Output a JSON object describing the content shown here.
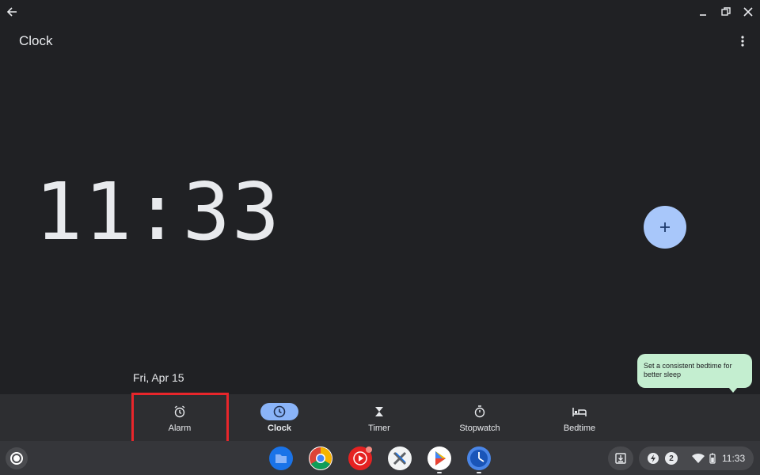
{
  "window": {
    "app_title": "Clock"
  },
  "clock": {
    "time": "11:33",
    "date": "Fri, Apr 15"
  },
  "tooltip": {
    "text": "Set a consistent bedtime for better sleep"
  },
  "nav": {
    "items": [
      {
        "label": "Alarm",
        "icon": "alarm-icon",
        "active": false
      },
      {
        "label": "Clock",
        "icon": "clock-icon",
        "active": true
      },
      {
        "label": "Timer",
        "icon": "hourglass-icon",
        "active": false
      },
      {
        "label": "Stopwatch",
        "icon": "stopwatch-icon",
        "active": false
      },
      {
        "label": "Bedtime",
        "icon": "bed-icon",
        "active": false
      }
    ]
  },
  "shelf": {
    "apps": [
      "files-icon",
      "chrome-icon",
      "youtube-music-icon",
      "app-icon",
      "play-store-icon",
      "clock-app-icon"
    ]
  },
  "tray": {
    "notification_count": "2",
    "time": "11:33"
  },
  "colors": {
    "accent": "#8ab4f8",
    "fab": "#a8c7fa",
    "tooltip_bg": "#c4eed0",
    "highlight": "#e8262b"
  }
}
